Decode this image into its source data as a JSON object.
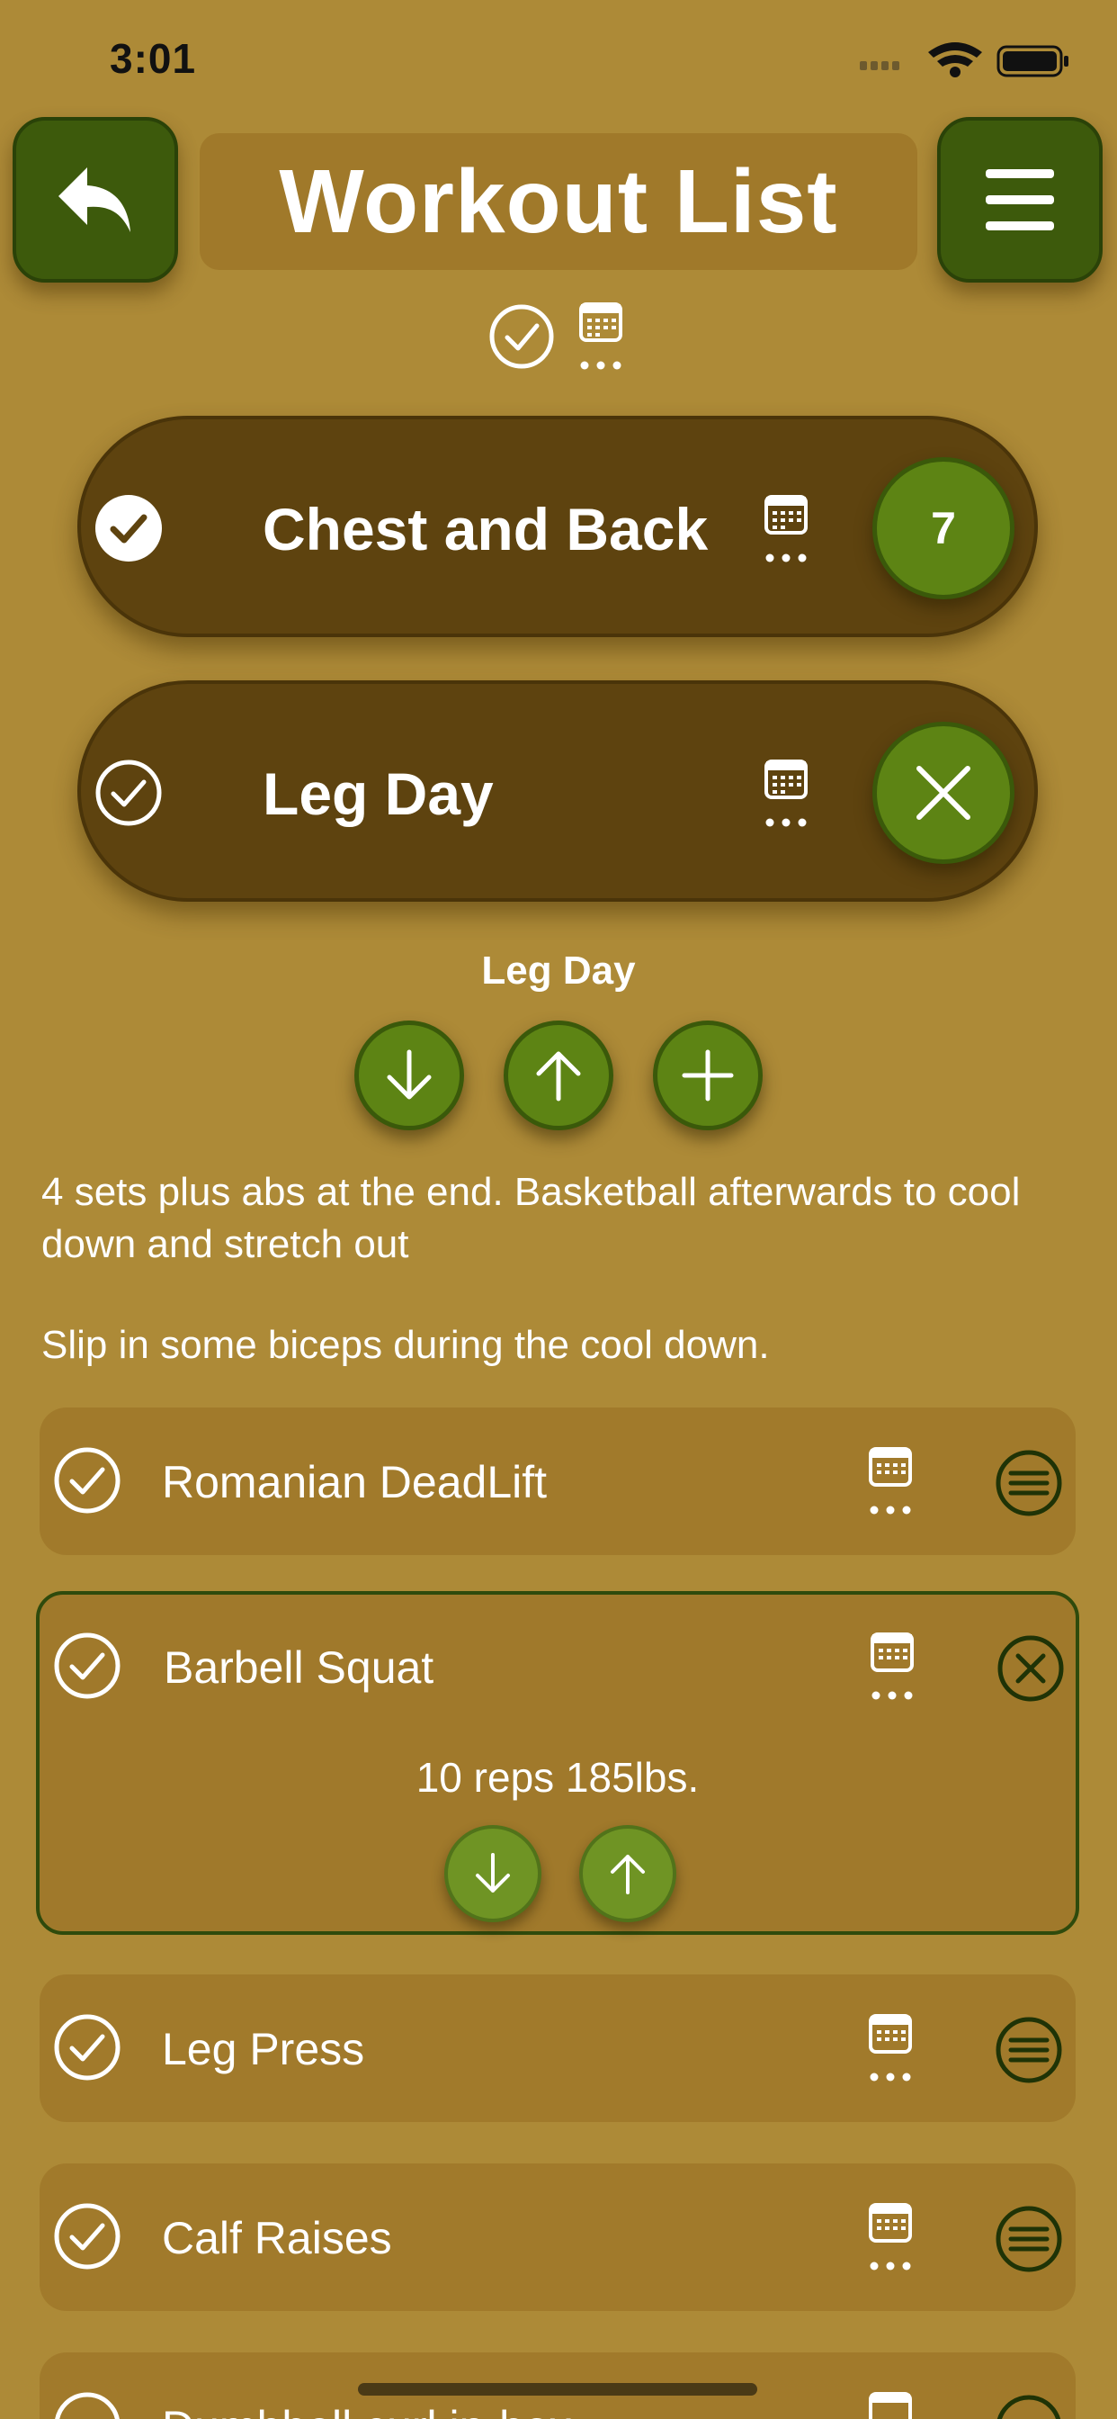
{
  "status_bar": {
    "time": "3:01"
  },
  "header": {
    "title": "Workout List",
    "back_icon": "reply-arrow-icon",
    "menu_icon": "hamburger-menu-icon"
  },
  "workout_days": [
    {
      "name": "Chest and Back",
      "completed": true,
      "badge": "7"
    },
    {
      "name": "Leg Day",
      "completed": false,
      "badge": ""
    }
  ],
  "selected_day": {
    "title": "Leg Day",
    "notes": [
      "4 sets plus abs at the end. Basketball afterwards to cool down and stretch out",
      "Slip in some biceps during the cool down."
    ]
  },
  "exercises": [
    {
      "name": "Romanian DeadLift"
    },
    {
      "name": "Barbell Squat",
      "detail": "10 reps 185lbs."
    },
    {
      "name": "Leg Press"
    },
    {
      "name": "Calf Raises"
    },
    {
      "name": "Dumbbell curl in-box"
    }
  ],
  "colors": {
    "background": "#ad8a37",
    "accent_green": "#3d5a0c",
    "pill_brown": "#5e430f",
    "row_brown": "#a17a2b"
  }
}
